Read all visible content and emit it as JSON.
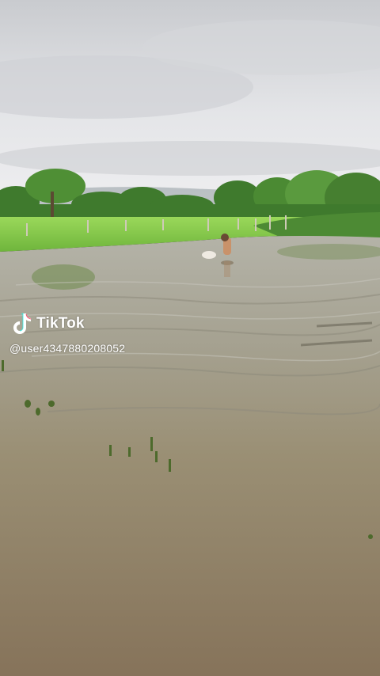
{
  "watermark": {
    "brand": "TikTok",
    "username": "@user4347880208052",
    "logo_icon": "tiktok-logo-icon"
  },
  "colors": {
    "sky": "#dcdde0",
    "grass": "#8fd14f",
    "trees": "#3d7a2e",
    "water_far": "#a9a89a",
    "water_near": "#8b7a5c",
    "watermark_text": "#ffffff"
  }
}
